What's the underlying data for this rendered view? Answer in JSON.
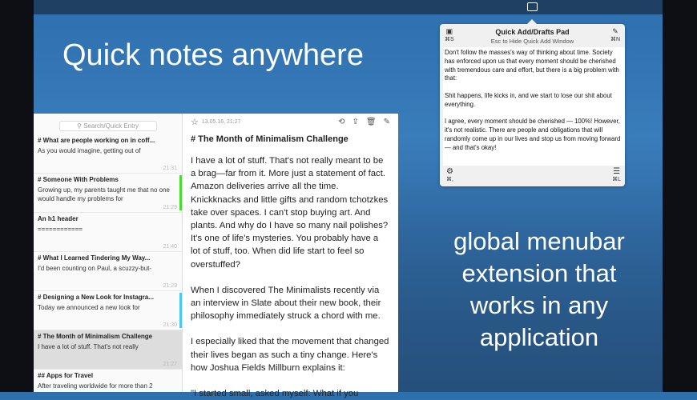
{
  "headline": "Quick notes anywhere",
  "tagline": [
    "global menubar",
    "extension that",
    "works in any",
    "application"
  ],
  "popover": {
    "title": "Quick Add/Drafts Pad",
    "subtitle": "Esc to Hide Quick Add Window",
    "save_shortcut": "⌘S",
    "new_shortcut": "⌘N",
    "settings_shortcut": "⌘,",
    "list_shortcut": "⌘L",
    "paragraphs": [
      "Don't follow the masses's way of thinking about time. Society has enforced upon us that every moment should be cherished with tremendous care and effort, but there is a big problem with that:",
      "Shit happens, life kicks in, and we start to lose our shit about everything.",
      "I agree, every moment should be cherished — 100%! However, it's not realistic. There are people and obligations that will randomly come up in our lives and stop us from moving forward — and that's okay!"
    ]
  },
  "sidebar": {
    "search_placeholder": "Search/Quick Entry",
    "notes": [
      {
        "title": "# What are people working on in coff...",
        "preview": "As you would imagine, getting out of",
        "time": "21:31",
        "color": ""
      },
      {
        "title": "# Someone With Problems",
        "preview": "Growing up, my parents taught me that no one would handle my problems for",
        "time": "21:29",
        "color": "#4cd936"
      },
      {
        "title": "An h1 header",
        "preview": "============",
        "time": "21:40",
        "color": ""
      },
      {
        "title": "# What I Learned Tindering My Way...",
        "preview": "I'd been counting on Paul, a scuzzy-but-",
        "time": "21:29",
        "color": ""
      },
      {
        "title": "# Designing a New Look for Instagra...",
        "preview": "Today we announced a new look for",
        "time": "21:30",
        "color": "#4ac8f0"
      },
      {
        "title": "# The Month of Minimalism Challenge",
        "preview": "I have a lot of stuff. That's not really",
        "time": "21:27",
        "color": ""
      },
      {
        "title": "## Apps for Travel",
        "preview": "After traveling worldwide for more than 2",
        "time": "",
        "color": ""
      }
    ]
  },
  "editor": {
    "date": "13.05.16, 21:27",
    "title": "# The Month of Minimalism Challenge",
    "paragraphs": [
      "I have a lot of stuff. That's not really meant to be a brag—far from it. More just a statement of fact. Amazon deliveries arrive all the time. Knickknacks and little gifts and random tchotzkes take over spaces. I can't stop buying art. And plants. And why do I have so many nail polishes? It's one of life's mysteries. You probably have a lot of stuff, too. When did life start to feel so overstuffed?",
      "When I discovered The Minimalists recently via an interview in Slate about their new book, their philosophy immediately struck a chord with me.",
      "I especially liked that the movement that changed their lives began as such a tiny change. Here's how Joshua Fields Millburn explains it:",
      "\"I started small, asked myself: What if you"
    ]
  }
}
